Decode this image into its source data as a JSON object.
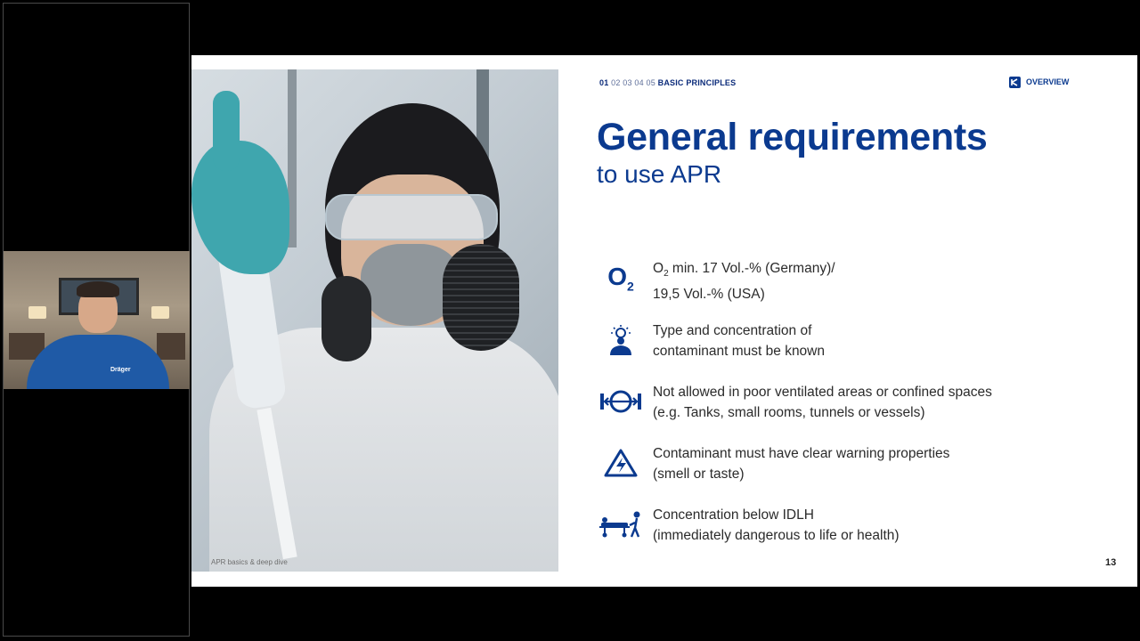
{
  "webcam": {
    "shirt_logo": "Dräger"
  },
  "slide": {
    "nav": {
      "active_step": "01",
      "steps": [
        "02",
        "03",
        "04",
        "05"
      ],
      "section": "BASIC PRINCIPLES"
    },
    "overview_label": "OVERVIEW",
    "title": "General requirements",
    "subtitle": "to use APR",
    "photo_caption": "APR basics & deep dive",
    "page_number": "13",
    "requirements": [
      {
        "icon": "o2-icon",
        "line1_prefix": "O",
        "line1_sub": "2",
        "line1_rest": " min. 17 Vol.-% (Germany)/",
        "line2": "19,5 Vol.-% (USA)"
      },
      {
        "icon": "person-idea-icon",
        "line1": "Type and concentration of",
        "line2": "contaminant must be known"
      },
      {
        "icon": "ventilation-icon",
        "line1": "Not allowed in poor ventilated areas or confined spaces",
        "line2": "(e.g. Tanks, small rooms, tunnels or vessels)"
      },
      {
        "icon": "warning-icon",
        "line1": "Contaminant must have clear warning properties",
        "line2": "(smell or taste)"
      },
      {
        "icon": "stretcher-icon",
        "line1": "Concentration below IDLH",
        "line2": "(immediately dangerous to life or health)"
      }
    ],
    "colors": {
      "brand_blue": "#0b3a8f",
      "text": "#2b2b2b"
    }
  }
}
